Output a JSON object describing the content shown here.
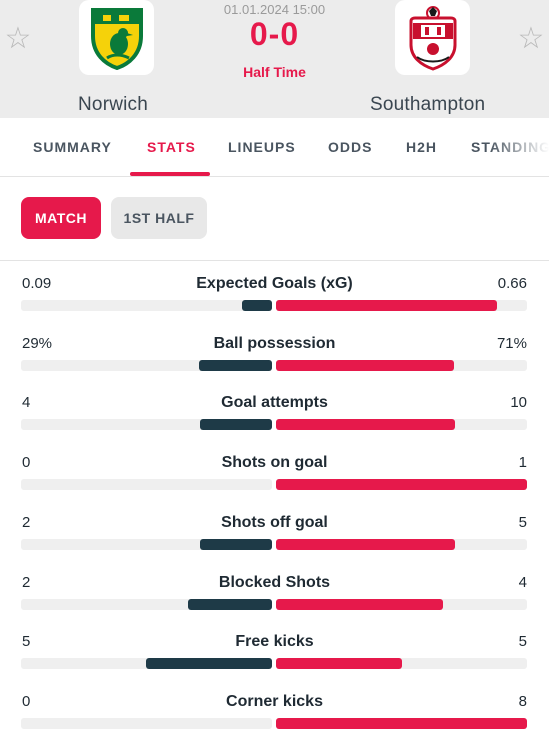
{
  "header": {
    "datetime": "01.01.2024 15:00",
    "score": "0-0",
    "status": "Half Time",
    "home_team": "Norwich",
    "away_team": "Southampton",
    "star_icon": "☆"
  },
  "tabs": [
    {
      "label": "SUMMARY"
    },
    {
      "label": "STATS"
    },
    {
      "label": "LINEUPS"
    },
    {
      "label": "ODDS"
    },
    {
      "label": "H2H"
    },
    {
      "label": "STANDINGS"
    }
  ],
  "active_tab": "STATS",
  "periods": {
    "match": "MATCH",
    "first_half": "1ST HALF"
  },
  "colors": {
    "accent": "#e6194b",
    "home_bar": "#1e3a47",
    "away_bar": "#e6194b"
  },
  "stats": [
    {
      "label": "Expected Goals (xG)",
      "home": "0.09",
      "away": "0.66",
      "home_share": 0.12,
      "away_share": 0.88
    },
    {
      "label": "Ball possession",
      "home": "29%",
      "away": "71%",
      "home_share": 0.29,
      "away_share": 0.71
    },
    {
      "label": "Goal attempts",
      "home": "4",
      "away": "10",
      "home_share": 0.286,
      "away_share": 0.714
    },
    {
      "label": "Shots on goal",
      "home": "0",
      "away": "1",
      "home_share": 0.0,
      "away_share": 1.0
    },
    {
      "label": "Shots off goal",
      "home": "2",
      "away": "5",
      "home_share": 0.286,
      "away_share": 0.714
    },
    {
      "label": "Blocked Shots",
      "home": "2",
      "away": "4",
      "home_share": 0.333,
      "away_share": 0.667
    },
    {
      "label": "Free kicks",
      "home": "5",
      "away": "5",
      "home_share": 0.5,
      "away_share": 0.5
    },
    {
      "label": "Corner kicks",
      "home": "0",
      "away": "8",
      "home_share": 0.0,
      "away_share": 1.0
    }
  ]
}
